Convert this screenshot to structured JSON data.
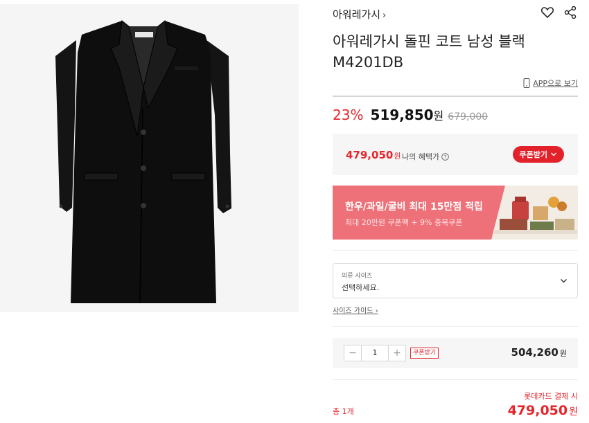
{
  "product": {
    "brand": "아워레가시",
    "title_line1": "아워레가시 돌핀 코트 남성 블랙",
    "title_line2": "M4201DB",
    "image_alt": "black wool coat"
  },
  "actions": {
    "app_link": "APP으로 보기",
    "wishlist_icon": "heart-icon",
    "share_icon": "share-icon"
  },
  "price": {
    "discount_rate": "23%",
    "sale_price": "519,850",
    "currency": "원",
    "original_price": "679,000"
  },
  "benefit": {
    "price": "479,050",
    "currency": "원",
    "label": "나의 혜택가",
    "coupon_button": "쿠폰받기"
  },
  "banner": {
    "title": "한우/과일/굴비 최대 15만점 적립",
    "subtitle": "최대 20만원 쿠폰팩 + 9% 중복쿠폰"
  },
  "option": {
    "label": "의류 사이즈",
    "placeholder": "선택하세요.",
    "size_guide": "사이즈 가이드"
  },
  "order": {
    "quantity": "1",
    "minus": "−",
    "plus": "+",
    "coupon_tag": "쿠폰받기",
    "line_price": "504,260",
    "currency": "원"
  },
  "total": {
    "card_label": "롯데카드 결제 시",
    "count": "총 1개",
    "price": "479,050",
    "currency": "원"
  },
  "colors": {
    "accent_red": "#e5262c",
    "banner_pink": "#ee7078",
    "panel_gray": "#f6f6f6"
  }
}
